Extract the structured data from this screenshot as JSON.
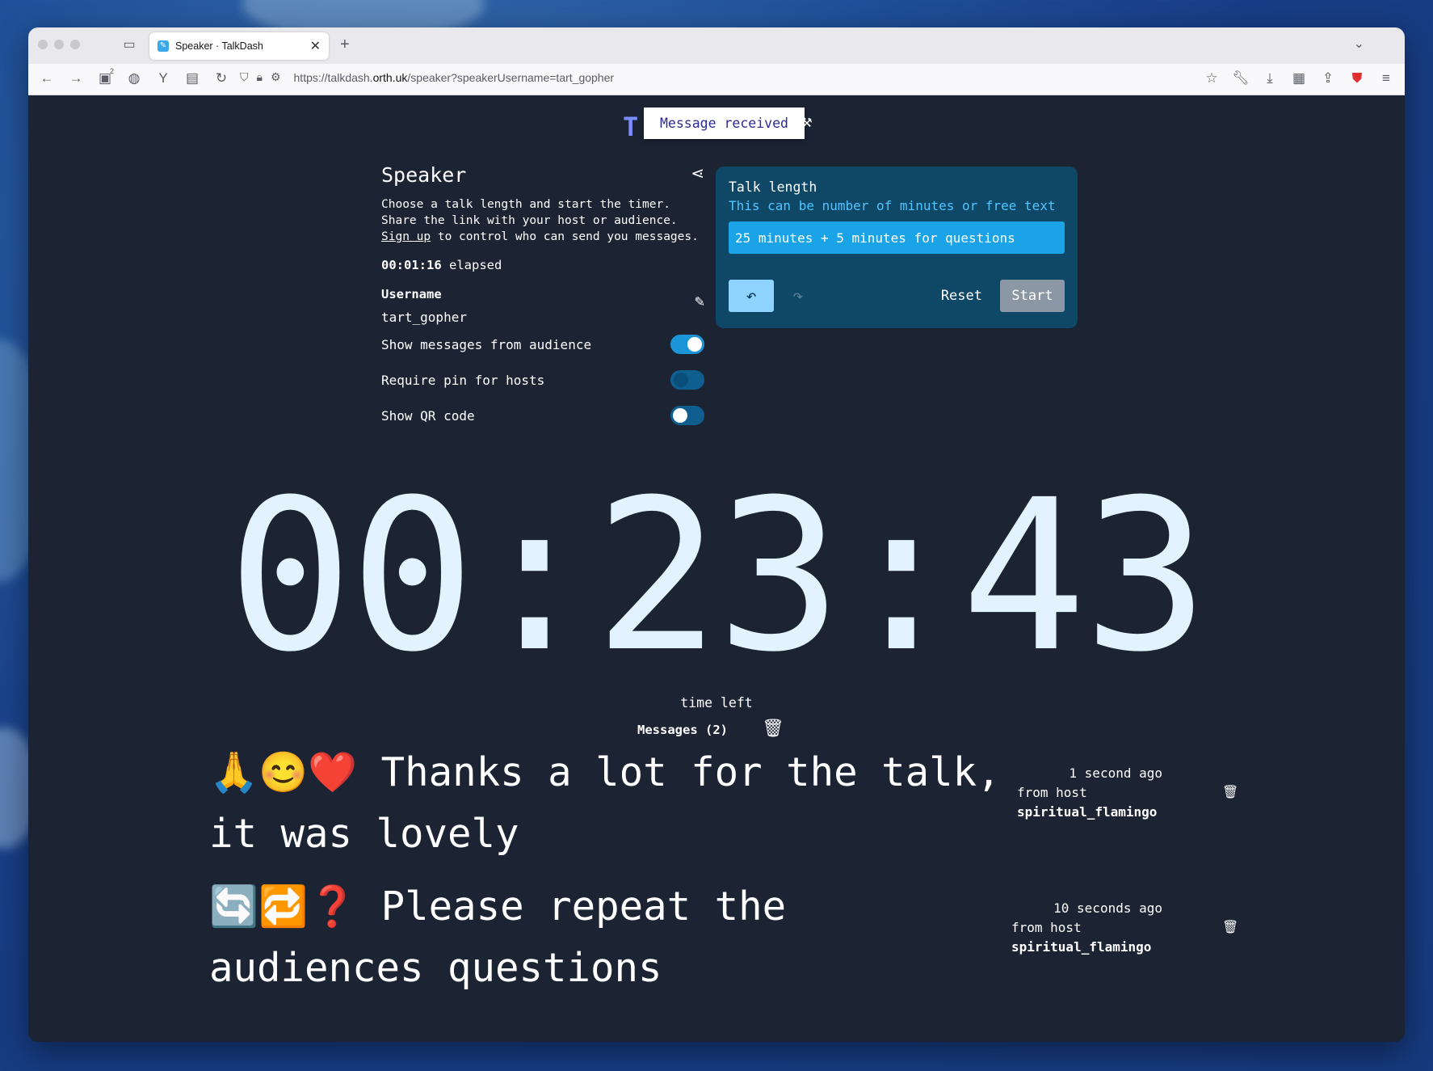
{
  "browser": {
    "tab_title": "Speaker · TalkDash",
    "tab_favicon": "talkdash-favicon",
    "url_prefix": "https://talkdash.",
    "url_domain": "orth.uk",
    "url_path": "/speaker?speakerUsername=tart_gopher",
    "badge_count": "2"
  },
  "toast": {
    "logo_letter": "T",
    "message": "Message received"
  },
  "speaker": {
    "title": "Speaker",
    "desc_line1": "Choose a talk length and start the timer.",
    "desc_line2": "Share the link with your host or audience.",
    "signup_link": "Sign up",
    "desc_line3_rest": " to control who can send you messages.",
    "elapsed_time": "00:01:16",
    "elapsed_label": " elapsed",
    "username_label": "Username",
    "username": "tart_gopher",
    "toggles": [
      {
        "label": "Show messages from audience",
        "state": "on"
      },
      {
        "label": "Require pin for hosts",
        "state": "on-dark"
      },
      {
        "label": "Show QR code",
        "state": "off"
      }
    ]
  },
  "talk_length": {
    "title": "Talk length",
    "hint": "This can be number of minutes or free text",
    "value": "25 minutes + 5 minutes for questions",
    "reset_label": "Reset",
    "start_label": "Start"
  },
  "timer": {
    "display": "00:23:43",
    "caption": "time left"
  },
  "messages": {
    "header": "Messages (2)",
    "items": [
      {
        "emoji": "🙏😊❤️",
        "text": "Thanks a lot for the talk, it was lovely",
        "ago": "1 second ago",
        "from": "from host",
        "sender": "spiritual_flamingo"
      },
      {
        "emoji": "🔄🔁❓",
        "text": "Please repeat the audiences questions",
        "ago": "10 seconds ago",
        "from": "from host",
        "sender": "spiritual_flamingo"
      }
    ]
  },
  "colors": {
    "page_bg": "#1c2434",
    "talk_panel_bg": "#0f4766",
    "accent": "#1aa3e6",
    "hint_text": "#52c5ff",
    "timer_text": "#e3f3fd"
  }
}
